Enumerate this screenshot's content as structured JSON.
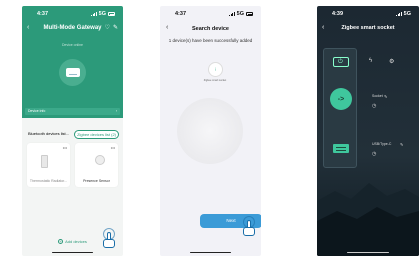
{
  "screen1": {
    "status_time": "4:37",
    "status_net": "5G",
    "title": "Multi-Mode Gateway",
    "subtitle": "Device online",
    "device_info_label": "Device info",
    "tabs": [
      "Bluetooth devices list...",
      "Zigbee devices list (2)"
    ],
    "cards": [
      {
        "label": "Thermostatic Radiator..."
      },
      {
        "label": "Presence Sensor"
      }
    ],
    "add_devices_label": "Add devices",
    "accent": "#2c9a7a"
  },
  "screen2": {
    "status_time": "4:37",
    "status_net": "5G",
    "title": "Search device",
    "message": "1 device(s) have been successfully added",
    "device_label": "Zigbee smart socket",
    "next_label": "Next",
    "button_color": "#3b9bd7"
  },
  "screen3": {
    "status_time": "4:39",
    "status_net": "5G",
    "title": "Zigbee smart socket",
    "socket_label": "Socket",
    "usb_label": "USB/Type-C",
    "accent": "#3fc79d"
  }
}
